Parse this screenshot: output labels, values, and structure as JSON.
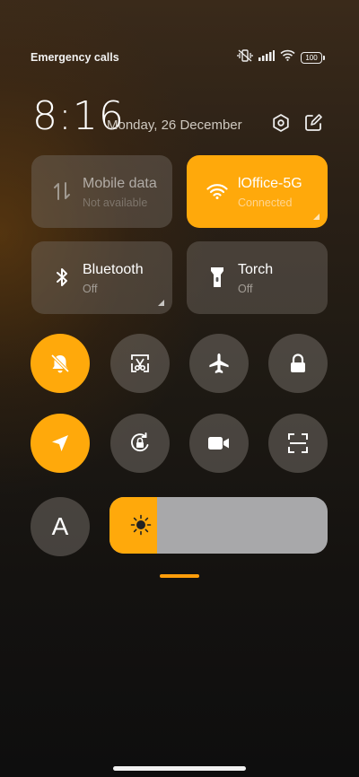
{
  "status": {
    "carrier": "Emergency calls o",
    "battery": "100"
  },
  "header": {
    "time": "8:16",
    "date": "Monday, 26 December"
  },
  "tiles": [
    {
      "name": "Mobile data",
      "sub": "Not available",
      "state": "disabled"
    },
    {
      "name": "lOffice-5G",
      "sub": "Connected",
      "state": "on"
    },
    {
      "name": "Bluetooth",
      "sub": "Off",
      "state": "off"
    },
    {
      "name": "Torch",
      "sub": "Off",
      "state": "off"
    }
  ],
  "toggles": [
    {
      "icon": "silent-bell-icon",
      "state": "on"
    },
    {
      "icon": "screenshot-icon",
      "state": "off"
    },
    {
      "icon": "airplane-icon",
      "state": "off"
    },
    {
      "icon": "lock-icon",
      "state": "off"
    },
    {
      "icon": "location-icon",
      "state": "on"
    },
    {
      "icon": "rotation-lock-icon",
      "state": "off"
    },
    {
      "icon": "video-camera-icon",
      "state": "off"
    },
    {
      "icon": "scanner-icon",
      "state": "off"
    }
  ],
  "auto_label": "A",
  "brightness_level": 0.22,
  "colors": {
    "accent": "#ffa90b",
    "tile_dark": "#6a625a",
    "slider_track": "#a8a8aa"
  }
}
